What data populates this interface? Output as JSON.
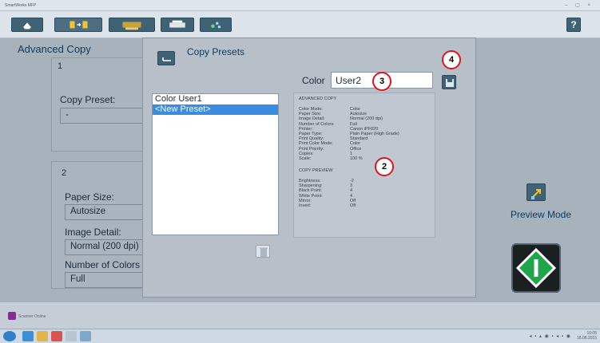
{
  "window": {
    "title": "SmartWorks MFP",
    "controls": "– ▢ ×"
  },
  "toolbar": {
    "help_label": "?"
  },
  "page": {
    "title": "Advanced Copy"
  },
  "step1": {
    "number": "1",
    "copy_preset_label": "Copy Preset:",
    "copy_preset_value": "-"
  },
  "step2": {
    "number": "2",
    "paper_size_label": "Paper Size:",
    "paper_size_value": "Autosize",
    "image_detail_label": "Image Detail:",
    "image_detail_value": "Normal (200 dpi)",
    "number_of_colors_label": "Number of Colors",
    "number_of_colors_value": "Full"
  },
  "preview": {
    "label": "Preview Mode"
  },
  "dialog": {
    "title": "Copy Presets",
    "presets": [
      "Color User1",
      "<New Preset>"
    ],
    "selected_index": 1,
    "color_label": "Color",
    "color_value": "User2",
    "summary": {
      "advanced_heading": "ADVANCED COPY",
      "advanced_rows": [
        {
          "k": "Color Mode:",
          "v": "Color"
        },
        {
          "k": "Paper Size:",
          "v": "Autosize"
        },
        {
          "k": "Image Detail:",
          "v": "Normal (200 dpi)"
        },
        {
          "k": "Number of Colors:",
          "v": "Full"
        },
        {
          "k": "Printer:",
          "v": "Canon iPF820"
        },
        {
          "k": "Paper Type:",
          "v": "Plain Paper (High Grade)"
        },
        {
          "k": "Print Quality:",
          "v": "Standard"
        },
        {
          "k": "Print Color Mode:",
          "v": "Color"
        },
        {
          "k": "Print Priority:",
          "v": "Office"
        },
        {
          "k": "Copies:",
          "v": "1"
        },
        {
          "k": "Scale:",
          "v": "100 %"
        }
      ],
      "preview_heading": "COPY PREVIEW",
      "preview_rows": [
        {
          "k": "Brightness:",
          "v": "-2"
        },
        {
          "k": "Sharpening:",
          "v": "3"
        },
        {
          "k": "Black Point:",
          "v": "4"
        },
        {
          "k": "White Point:",
          "v": "4"
        },
        {
          "k": "Mirror:",
          "v": "Off"
        },
        {
          "k": "Invert:",
          "v": "Off"
        }
      ]
    }
  },
  "callouts": [
    "4",
    "3",
    "2"
  ],
  "footer": {
    "brand": "Scanner Online"
  },
  "clock": {
    "time": "10:05",
    "date": "18.08.2015"
  },
  "colors": {
    "accent": "#3f6275",
    "selection": "#3a8ce0",
    "callout": "#e0141a"
  }
}
